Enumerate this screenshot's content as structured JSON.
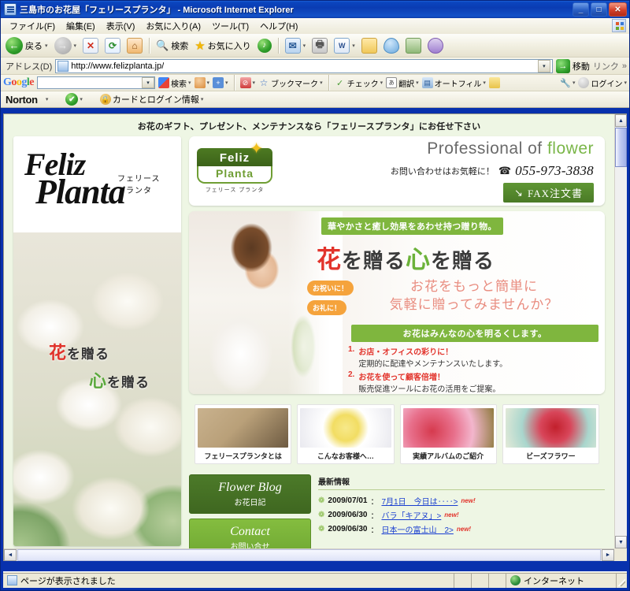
{
  "window": {
    "title": "三島市のお花屋「フェリースプランタ」 - Microsoft Internet Explorer",
    "minimize_label": "_",
    "maximize_label": "□",
    "close_label": "✕"
  },
  "menubar": [
    {
      "label": "ファイル(F)"
    },
    {
      "label": "編集(E)"
    },
    {
      "label": "表示(V)"
    },
    {
      "label": "お気に入り(A)"
    },
    {
      "label": "ツール(T)"
    },
    {
      "label": "ヘルプ(H)"
    }
  ],
  "toolbar": {
    "back_label": "戻る",
    "forward_label": "",
    "stop_label": "✕",
    "refresh_label": "⟳",
    "home_label": "⌂",
    "search_label": "検索",
    "favorites_label": "お気に入り",
    "media_label": "",
    "mail_label": "✉",
    "print_label": "",
    "edit_label": "W",
    "note_label": "",
    "drop_label": "",
    "research_label": "",
    "messenger_label": "",
    "caret": "▾"
  },
  "address": {
    "label": "アドレス(D)",
    "value": "http://www.felizplanta.jp/",
    "placeholder": "",
    "dropdown_caret": "▾",
    "go_label": "移動",
    "go_icon": "→",
    "links_label": "リンク",
    "overflow": "»"
  },
  "google_toolbar": {
    "logo": "Google",
    "search_value": "",
    "search_placeholder": "",
    "dropdown_caret": "▾",
    "items": [
      {
        "label": "検索"
      },
      {
        "label": ""
      },
      {
        "label": ""
      },
      {
        "label": ""
      },
      {
        "label": "ブックマーク"
      },
      {
        "label": "チェック"
      },
      {
        "label": "翻訳"
      },
      {
        "label": "オートフィル"
      },
      {
        "label": ""
      },
      {
        "label": ""
      },
      {
        "label": "ログイン"
      }
    ]
  },
  "norton_toolbar": {
    "logo": "Norton",
    "caret": "▾",
    "status_label": "✔",
    "card_label": "カードとログイン情報"
  },
  "page": {
    "tagline": "お花のギフト、プレゼント、メンテナンスなら「フェリースプランタ」にお任せ下さい",
    "left": {
      "logo_line1": "Feliz",
      "logo_line2": "Planta",
      "logo_kana1": "フェリース",
      "logo_kana2": "プランタ",
      "copy_red": "花",
      "copy_line1": "を贈る",
      "copy_green": "心",
      "copy_line2": "を贈る"
    },
    "header": {
      "badge_top": "Feliz",
      "badge_bottom": "Planta",
      "badge_kana": "フェリース プランタ",
      "star": "✦",
      "professional_prefix": "Professional of ",
      "professional_highlight": "flower",
      "contact_label": "お問い合わせはお気軽に！",
      "phone_icon": "☎",
      "phone": "055-973-3838",
      "fax_icon": "↘",
      "fax_label": "FAX注文書"
    },
    "banner": {
      "green_bar": "華やかさと癒し効果をあわせ持つ贈り物。",
      "headline_red": "花",
      "headline_1": "を贈る",
      "headline_green": "心",
      "headline_2": "を贈る",
      "pill_1": "お祝いに！",
      "pill_2": "お礼に！",
      "subcopy_1": "お花をもっと簡単に",
      "subcopy_2": "気軽に贈ってみませんか？",
      "green_bar2": "お花はみんなの心を明るくします。",
      "points": [
        {
          "num": "1.",
          "heading": "お店・オフィスの彩りに！",
          "detail": "定期的に配達やメンテナンスいたします。"
        },
        {
          "num": "2.",
          "heading": "お花を使って顧客倍増！",
          "detail": "販売促進ツールにお花の活用をご提案。"
        }
      ]
    },
    "thumbnails": [
      {
        "caption": "フェリースプランタとは"
      },
      {
        "caption": "こんなお客様へ…"
      },
      {
        "caption": "実績アルバムのご紹介"
      },
      {
        "caption": "ビーズフラワー"
      }
    ],
    "buttons": [
      {
        "en": "Flower Blog",
        "jp": "お花日記"
      },
      {
        "en": "Contact",
        "jp": "お問い合せ"
      }
    ],
    "news": {
      "title": "最新情報",
      "items": [
        {
          "icon": "❁",
          "date": "2009/07/01",
          "sep": "：",
          "link": "7月1日　今日は‥‥>",
          "badge": "new!"
        },
        {
          "icon": "❁",
          "date": "2009/06/30",
          "sep": "：",
          "link": "バラ「キアヌ」>",
          "badge": "new!"
        },
        {
          "icon": "❁",
          "date": "2009/06/30",
          "sep": "：",
          "link": "日本一の富士山　2>",
          "badge": "new!"
        }
      ]
    }
  },
  "scrollbars": {
    "up": "▲",
    "down": "▼",
    "left": "◄",
    "right": "►"
  },
  "statusbar": {
    "message": "ページが表示されました",
    "zone": "インターネット"
  },
  "colors": {
    "green_accent": "#7fb63e",
    "dark_green": "#4c7a29",
    "red_accent": "#e2342c",
    "orange_pill": "#f5a33c",
    "link_blue": "#1a3fd0",
    "page_bg": "#eef6e4"
  }
}
